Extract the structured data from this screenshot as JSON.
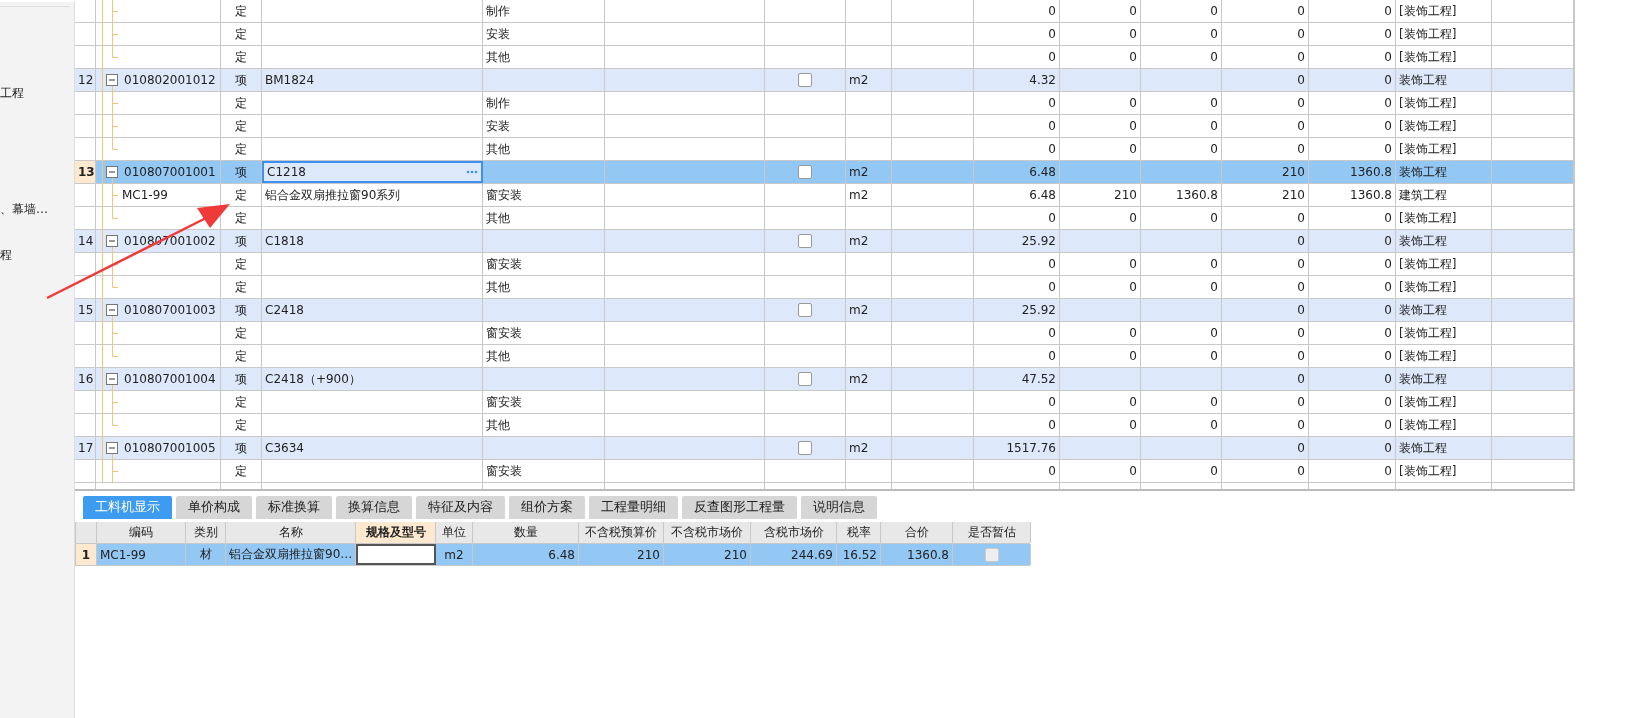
{
  "sidebar": {
    "items": [
      "工程",
      "、幕墙…",
      "程"
    ]
  },
  "main_table": {
    "rows": [
      {
        "kind": "sub",
        "selected": false,
        "type": "定",
        "content": "制作",
        "quantity": "0",
        "values": [
          "0",
          "0",
          "0",
          "0"
        ],
        "category": "[装饰工程]"
      },
      {
        "kind": "sub",
        "selected": false,
        "type": "定",
        "content": "安装",
        "quantity": "0",
        "values": [
          "0",
          "0",
          "0",
          "0"
        ],
        "category": "[装饰工程]"
      },
      {
        "kind": "sub",
        "selected": false,
        "type": "定",
        "content": "其他",
        "quantity": "0",
        "values": [
          "0",
          "0",
          "0",
          "0"
        ],
        "category": "[装饰工程]"
      },
      {
        "kind": "item",
        "selected": false,
        "number": "12",
        "code": "010802001012",
        "expanded": true,
        "type": "项",
        "name": "BM1824",
        "checked": false,
        "unit": "m2",
        "quantity": "4.32",
        "values": [
          "0",
          "0"
        ],
        "category": "装饰工程"
      },
      {
        "kind": "sub",
        "selected": false,
        "type": "定",
        "content": "制作",
        "quantity": "0",
        "values": [
          "0",
          "0",
          "0",
          "0"
        ],
        "category": "[装饰工程]"
      },
      {
        "kind": "sub",
        "selected": false,
        "type": "定",
        "content": "安装",
        "quantity": "0",
        "values": [
          "0",
          "0",
          "0",
          "0"
        ],
        "category": "[装饰工程]"
      },
      {
        "kind": "sub",
        "selected": false,
        "type": "定",
        "content": "其他",
        "quantity": "0",
        "values": [
          "0",
          "0",
          "0",
          "0"
        ],
        "category": "[装饰工程]"
      },
      {
        "kind": "item",
        "selected": true,
        "number": "13",
        "code": "010807001001",
        "expanded": true,
        "type": "项",
        "name": "C1218",
        "checked": false,
        "unit": "m2",
        "quantity": "6.48",
        "values": [
          "210",
          "1360.8"
        ],
        "category": "装饰工程"
      },
      {
        "kind": "sub",
        "selected": false,
        "code": "MC1-99",
        "type": "定",
        "name": "铝合金双扇推拉窗90系列",
        "content": "窗安装",
        "unit": "m2",
        "quantity": "6.48",
        "values": [
          "210",
          "1360.8",
          "210",
          "1360.8"
        ],
        "category": "建筑工程"
      },
      {
        "kind": "sub",
        "selected": false,
        "type": "定",
        "content": "其他",
        "quantity": "0",
        "values": [
          "0",
          "0",
          "0",
          "0"
        ],
        "category": "[装饰工程]"
      },
      {
        "kind": "item",
        "selected": false,
        "number": "14",
        "code": "010807001002",
        "expanded": true,
        "type": "项",
        "name": "C1818",
        "checked": false,
        "unit": "m2",
        "quantity": "25.92",
        "values": [
          "0",
          "0"
        ],
        "category": "装饰工程"
      },
      {
        "kind": "sub",
        "selected": false,
        "type": "定",
        "content": "窗安装",
        "quantity": "0",
        "values": [
          "0",
          "0",
          "0",
          "0"
        ],
        "category": "[装饰工程]"
      },
      {
        "kind": "sub",
        "selected": false,
        "type": "定",
        "content": "其他",
        "quantity": "0",
        "values": [
          "0",
          "0",
          "0",
          "0"
        ],
        "category": "[装饰工程]"
      },
      {
        "kind": "item",
        "selected": false,
        "number": "15",
        "code": "010807001003",
        "expanded": true,
        "type": "项",
        "name": "C2418",
        "checked": false,
        "unit": "m2",
        "quantity": "25.92",
        "values": [
          "0",
          "0"
        ],
        "category": "装饰工程"
      },
      {
        "kind": "sub",
        "selected": false,
        "type": "定",
        "content": "窗安装",
        "quantity": "0",
        "values": [
          "0",
          "0",
          "0",
          "0"
        ],
        "category": "[装饰工程]"
      },
      {
        "kind": "sub",
        "selected": false,
        "type": "定",
        "content": "其他",
        "quantity": "0",
        "values": [
          "0",
          "0",
          "0",
          "0"
        ],
        "category": "[装饰工程]"
      },
      {
        "kind": "item",
        "selected": false,
        "number": "16",
        "code": "010807001004",
        "expanded": true,
        "type": "项",
        "name": "C2418（+900）",
        "checked": false,
        "unit": "m2",
        "quantity": "47.52",
        "values": [
          "0",
          "0"
        ],
        "category": "装饰工程"
      },
      {
        "kind": "sub",
        "selected": false,
        "type": "定",
        "content": "窗安装",
        "quantity": "0",
        "values": [
          "0",
          "0",
          "0",
          "0"
        ],
        "category": "[装饰工程]"
      },
      {
        "kind": "sub",
        "selected": false,
        "type": "定",
        "content": "其他",
        "quantity": "0",
        "values": [
          "0",
          "0",
          "0",
          "0"
        ],
        "category": "[装饰工程]"
      },
      {
        "kind": "item",
        "selected": false,
        "number": "17",
        "code": "010807001005",
        "expanded": true,
        "type": "项",
        "name": "C3634",
        "checked": false,
        "unit": "m2",
        "quantity": "1517.76",
        "values": [
          "0",
          "0"
        ],
        "category": "装饰工程"
      },
      {
        "kind": "sub",
        "selected": false,
        "type": "定",
        "content": "窗安装",
        "quantity": "0",
        "values": [
          "0",
          "0",
          "0",
          "0"
        ],
        "category": "[装饰工程]"
      }
    ]
  },
  "detail_panel": {
    "tabs": [
      {
        "label": "工料机显示",
        "selected": true
      },
      {
        "label": "单价构成",
        "selected": false
      },
      {
        "label": "标准换算",
        "selected": false
      },
      {
        "label": "换算信息",
        "selected": false
      },
      {
        "label": "特征及内容",
        "selected": false
      },
      {
        "label": "组价方案",
        "selected": false
      },
      {
        "label": "工程量明细",
        "selected": false
      },
      {
        "label": "反查图形工程量",
        "selected": false
      },
      {
        "label": "说明信息",
        "selected": false
      }
    ],
    "table": {
      "columns": [
        {
          "label": "编码",
          "selected": false
        },
        {
          "label": "类别",
          "selected": false
        },
        {
          "label": "名称",
          "selected": false
        },
        {
          "label": "规格及型号",
          "selected": true
        },
        {
          "label": "单位",
          "selected": false
        },
        {
          "label": "数量",
          "selected": false
        },
        {
          "label": "不含税预算价",
          "selected": false
        },
        {
          "label": "不含税市场价",
          "selected": false
        },
        {
          "label": "含税市场价",
          "selected": false
        },
        {
          "label": "税率",
          "selected": false
        },
        {
          "label": "合价",
          "selected": false
        },
        {
          "label": "是否暂估",
          "selected": false
        }
      ],
      "rows": [
        {
          "number": "1",
          "selected": true,
          "code": "MC1-99",
          "category": "材",
          "name": "铝合金双扇推拉窗90…",
          "unit": "m2",
          "quantity": "6.48",
          "budget_price": "210",
          "market_price": "210",
          "market_price_with_tax": "244.69",
          "tax_rate": "16.52",
          "total": "1360.8",
          "provisional": false
        }
      ]
    }
  }
}
